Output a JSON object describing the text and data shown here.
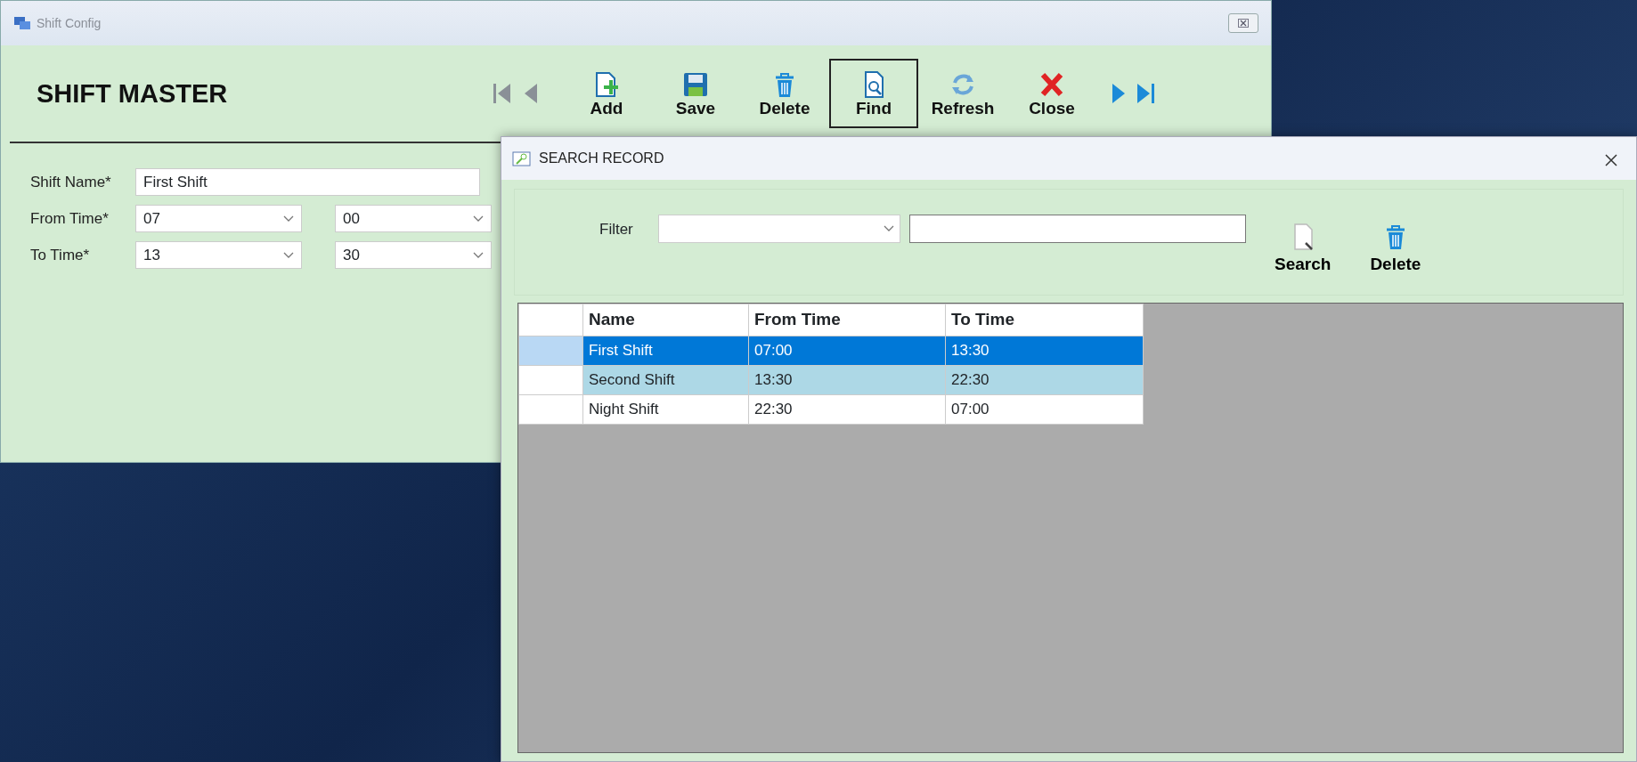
{
  "main_window": {
    "title": "Shift Config",
    "heading": "SHIFT MASTER",
    "nav_buttons": [
      {
        "kind": "first"
      },
      {
        "kind": "prev"
      }
    ],
    "toolbar": [
      {
        "kind": "add",
        "label": "Add",
        "focused": false
      },
      {
        "kind": "save",
        "label": "Save",
        "focused": false
      },
      {
        "kind": "delete",
        "label": "Delete",
        "focused": false
      },
      {
        "kind": "find",
        "label": "Find",
        "focused": true
      },
      {
        "kind": "refresh",
        "label": "Refresh",
        "focused": false
      },
      {
        "kind": "close",
        "label": "Close",
        "focused": false
      }
    ],
    "nav_buttons_end": [
      {
        "kind": "next"
      },
      {
        "kind": "last"
      }
    ],
    "form": [
      {
        "label": "Shift Name*",
        "kind": "text",
        "value": "First Shift"
      },
      {
        "label": "From Time*",
        "kind": "time",
        "hour": "07",
        "minute": "00"
      },
      {
        "label": "To Time*",
        "kind": "time",
        "hour": "13",
        "minute": "30"
      }
    ]
  },
  "search_dialog": {
    "title": "SEARCH RECORD",
    "filter_label": "Filter",
    "buttons": [
      {
        "kind": "search",
        "label": "Search"
      },
      {
        "kind": "delete",
        "label": "Delete"
      }
    ],
    "table": {
      "columns": [
        "Name",
        "From Time",
        "To Time"
      ],
      "rows": [
        {
          "cells": [
            "First Shift",
            "07:00",
            "13:30"
          ],
          "selected": true,
          "highlighted": false
        },
        {
          "cells": [
            "Second Shift",
            "13:30",
            "22:30"
          ],
          "selected": false,
          "highlighted": true
        },
        {
          "cells": [
            "Night Shift",
            "22:30",
            "07:00"
          ],
          "selected": false,
          "highlighted": false
        }
      ]
    }
  }
}
